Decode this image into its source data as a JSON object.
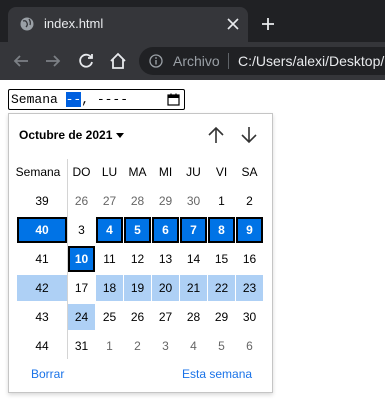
{
  "browser": {
    "tab_title": "index.html",
    "omnibox_label": "Archivo",
    "url": "C:/Users/alexi/Desktop/"
  },
  "week_input": {
    "prefix": "Semana ",
    "active_segment": "--",
    "rest": ", ----"
  },
  "picker": {
    "month_label": "Octubre de 2021",
    "headers": [
      "Semana",
      "DO",
      "LU",
      "MA",
      "MI",
      "JU",
      "VI",
      "SA"
    ],
    "weeks": [
      {
        "week": "39",
        "days": [
          "26",
          "27",
          "28",
          "29",
          "30",
          "1",
          "2"
        ],
        "dim": [
          true,
          true,
          true,
          true,
          true,
          false,
          false
        ]
      },
      {
        "week": "40",
        "days": [
          "3",
          "4",
          "5",
          "6",
          "7",
          "8",
          "9"
        ],
        "dim": [
          false,
          false,
          false,
          false,
          false,
          false,
          false
        ]
      },
      {
        "week": "41",
        "days": [
          "10",
          "11",
          "12",
          "13",
          "14",
          "15",
          "16"
        ],
        "dim": [
          false,
          false,
          false,
          false,
          false,
          false,
          false
        ]
      },
      {
        "week": "42",
        "days": [
          "17",
          "18",
          "19",
          "20",
          "21",
          "22",
          "23"
        ],
        "dim": [
          false,
          false,
          false,
          false,
          false,
          false,
          false
        ]
      },
      {
        "week": "43",
        "days": [
          "24",
          "25",
          "26",
          "27",
          "28",
          "29",
          "30"
        ],
        "dim": [
          false,
          false,
          false,
          false,
          false,
          false,
          false
        ]
      },
      {
        "week": "44",
        "days": [
          "31",
          "1",
          "2",
          "3",
          "4",
          "5",
          "6"
        ],
        "dim": [
          false,
          true,
          true,
          true,
          true,
          true,
          true
        ]
      }
    ],
    "selected_week": "40",
    "hover_week": "42",
    "today": "10",
    "clear_label": "Borrar",
    "this_week_label": "Esta semana",
    "colors": {
      "selected": "#0073e6",
      "hover": "#aed0f5",
      "link": "#1a73e8"
    }
  }
}
